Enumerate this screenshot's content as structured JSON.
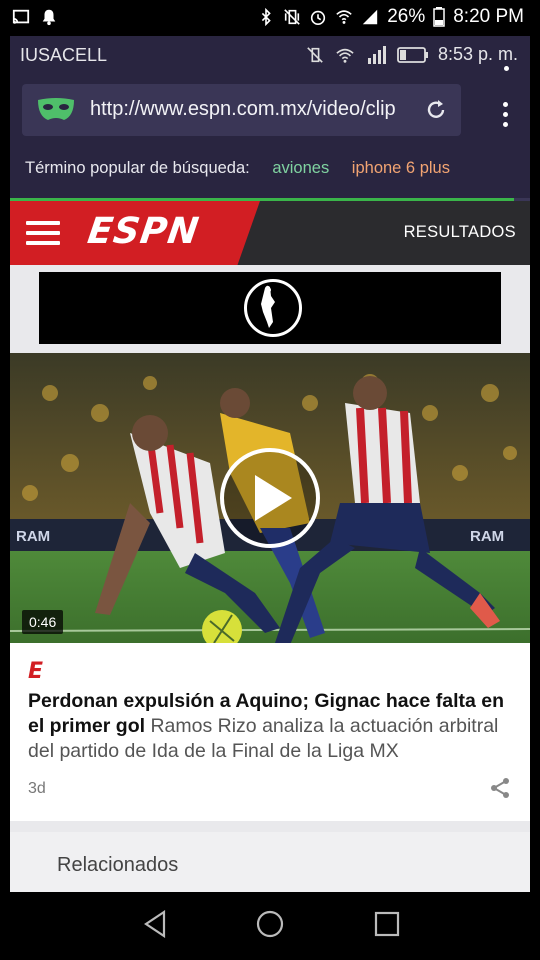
{
  "outer_status": {
    "battery": "26%",
    "time": "8:20 PM",
    "icons": [
      "cast-icon",
      "notification-icon",
      "bluetooth-icon",
      "vibrate-icon",
      "alarm-icon",
      "wifi-icon",
      "signal-icon",
      "battery-icon"
    ]
  },
  "inner_status": {
    "carrier": "IUSACELL",
    "time": "8:53 p. m."
  },
  "browser": {
    "url": "http://www.espn.com.mx/video/clip",
    "popular_label": "Término popular de búsqueda:",
    "popular_terms": [
      "aviones",
      "iphone 6 plus"
    ],
    "colors": {
      "term1": "#7fd2a0",
      "term2": "#f2a472",
      "progress": "#3ab54a"
    },
    "progress": 0.97
  },
  "espn": {
    "logo": "ESPN",
    "results_label": "RESULTADOS",
    "brand_color": "#d21e23"
  },
  "video": {
    "duration": "0:46"
  },
  "article": {
    "headline": "Perdonan expulsión a Aquino; Gignac hace falta en el primer gol",
    "summary": "Ramos Rizo analiza la actuación arbitral del partido de Ida de la Final de la Liga MX",
    "age": "3d"
  },
  "related": {
    "label": "Relacionados"
  }
}
